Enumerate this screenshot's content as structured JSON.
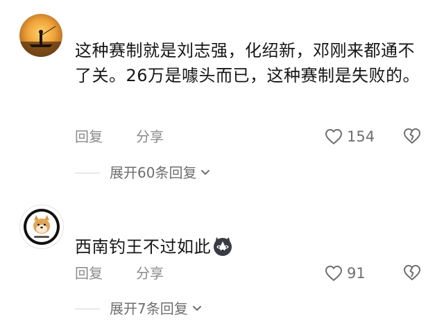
{
  "comments": [
    {
      "text": "这种赛制就是刘志强，化绍新，邓刚来都通不了关。26万是噱头而已，这种赛制是失败的。",
      "reply_label": "回复",
      "share_label": "分享",
      "like_count": "154",
      "expand_label": "展开60条回复",
      "avatar_icon": "sunset-fisherman-avatar"
    },
    {
      "text": "西南钓王不过如此",
      "emoji_icon": "husky-dog-emoji",
      "reply_label": "回复",
      "share_label": "分享",
      "like_count": "91",
      "expand_label": "展开7条回复",
      "avatar_icon": "shiba-dog-avatar"
    }
  ],
  "colors": {
    "text": "#161616",
    "meta": "#8a8a8a",
    "divider": "#d4d4d4"
  }
}
